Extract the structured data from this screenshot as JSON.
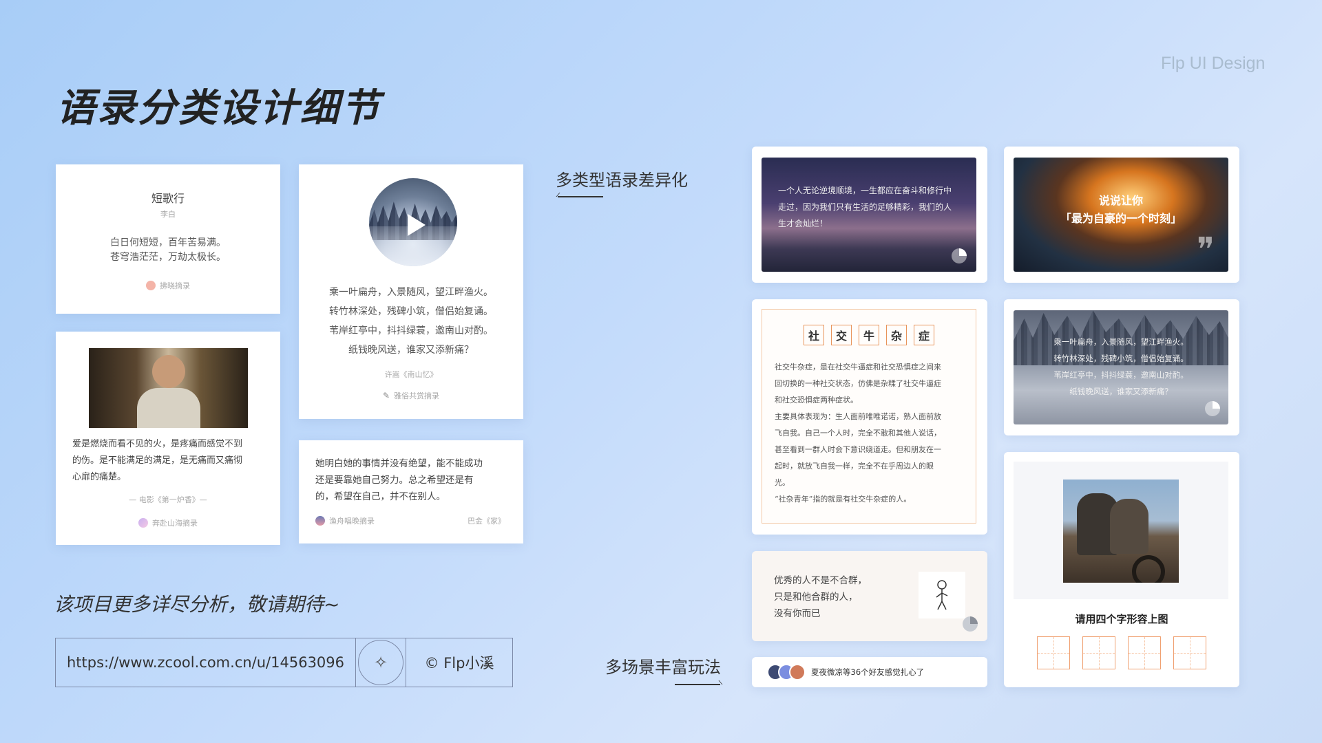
{
  "watermark": "Flp UI Design",
  "page_title": "语录分类设计细节",
  "labels": {
    "types": "多类型语录差异化",
    "scenes": "多场景丰富玩法"
  },
  "card_poem_short": {
    "title": "短歌行",
    "author": "李白",
    "line1": "白日何短短，百年苦易满。",
    "line2": "苍穹浩茫茫，万劫太极长。",
    "by": "拂晓摘录"
  },
  "card_video": {
    "lines": [
      "乘一叶扁舟，入景随风，望江畔渔火。",
      "转竹林深处，残碑小筑，僧侣始复诵。",
      "苇岸红亭中，抖抖绿蓑，邀南山对酌。",
      "纸钱晚风送，谁家又添新痛？"
    ],
    "source": "许嵩《南山忆》",
    "by": "雅俗共赏摘录"
  },
  "card_movie": {
    "lines": [
      "爱是燃烧而看不见的火，是疼痛而感觉不到",
      "的伤。是不能满足的满足，是无痛而又痛彻",
      "心扉的痛楚。"
    ],
    "source": "— 电影《第一炉香》—",
    "by": "奔赴山海摘录"
  },
  "card_quote": {
    "lines": [
      "她明白她的事情并没有绝望，能不能成功",
      "还是要靠她自己努力。总之希望还是有",
      "的，希望在自己，并不在别人。"
    ],
    "by": "渔舟唱晚摘录",
    "source": "巴金《家》"
  },
  "bottom": {
    "tagline": "该项目更多详尽分析，敬请期待~",
    "url": "https://www.zcool.com.cn/u/14563096",
    "icon": "sparkle-icon",
    "copyright": "© Flp小溪"
  },
  "r_dusk": {
    "lines": [
      "一个人无论逆境顺境，一生都应在奋斗和修行中",
      "走过，因为我们只有生活的足够精彩，我们的人",
      "生才会灿烂！"
    ]
  },
  "r_spark": {
    "line1": "说说让你",
    "line2": "「最为自豪的一个时刻」",
    "quote_mark": "❞"
  },
  "r_social": {
    "words": [
      "社",
      "交",
      "牛",
      "杂",
      "症"
    ],
    "paras": [
      "社交牛杂症，是在社交牛逼症和社交恐惧症之间来",
      "回切换的一种社交状态，仿佛是杂糅了社交牛逼症",
      "和社交恐惧症两种症状。",
      "主要具体表现为：生人面前唯唯诺诺，熟人面前放",
      "飞自我。自己一个人时，完全不敢和其他人说话，",
      "甚至看到一群人时会下意识绕道走。但和朋友在一",
      "起时，就放飞自我一样，完全不在乎周边人的眼",
      "光。",
      "“社杂青年”指的就是有社交牛杂症的人。"
    ]
  },
  "r_forest": {
    "lines": [
      "乘一叶扁舟，入景随风，望江畔渔火。",
      "转竹林深处，残碑小筑，僧侣始复诵。",
      "苇岸红亭中，抖抖绿蓑，邀南山对酌。",
      "纸钱晚风送，谁家又添新痛？"
    ]
  },
  "r_excellent": {
    "lines": [
      "优秀的人不是不合群，",
      "只是和他合群的人，",
      "没有你而已"
    ]
  },
  "r_picture": {
    "caption": "请用四个字形容上图"
  },
  "r_friends": {
    "text": "夏夜微凉等36个好友感觉扎心了"
  },
  "colors": {
    "accent_orange": "#e8945a",
    "border_blue": "#7d8aa8"
  }
}
